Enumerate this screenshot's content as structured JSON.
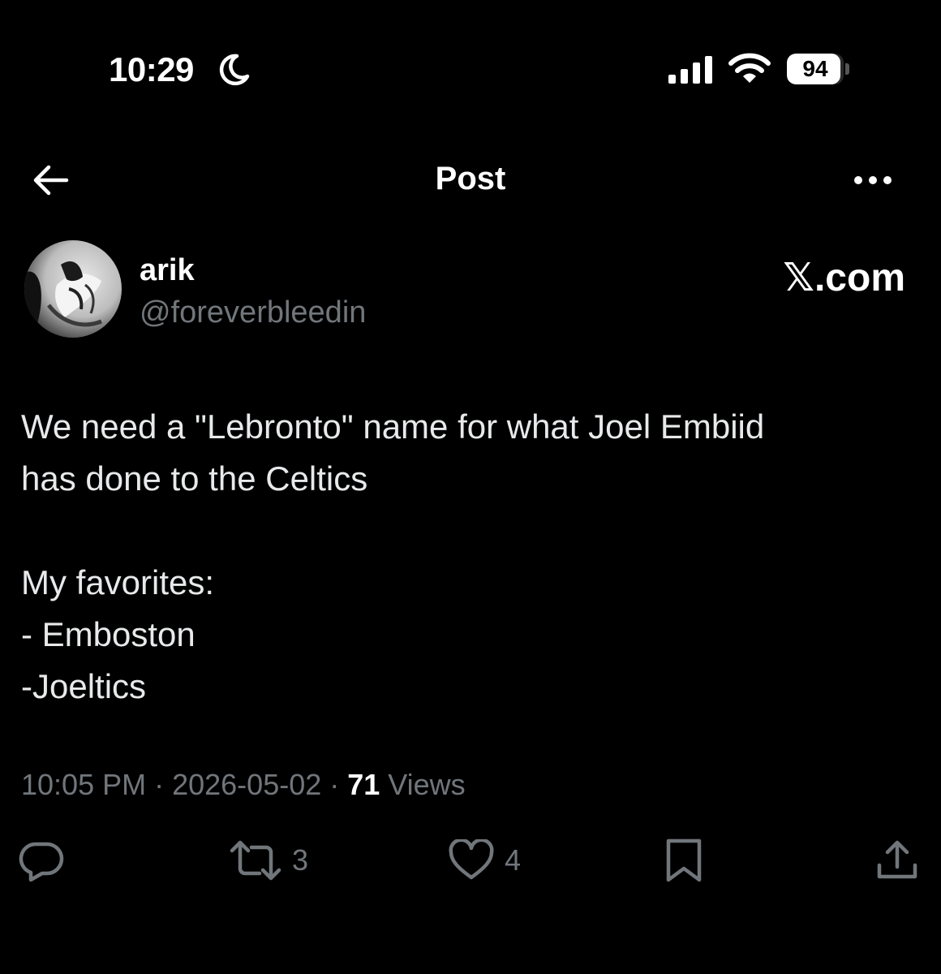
{
  "status_bar": {
    "time": "10:29",
    "battery_level": "94",
    "battery_fraction": 0.94
  },
  "nav": {
    "title": "Post"
  },
  "author": {
    "name": "arik",
    "handle": "@foreverbleedin"
  },
  "source_label": "𝕏.com",
  "post": {
    "text_lines": [
      "We need a \"Lebronto\" name for what Joel Embiid",
      "has done to the Celtics",
      "",
      "My favorites:",
      "- Emboston",
      "-Joeltics"
    ],
    "time": "10:05 PM",
    "date": "2026-05-02",
    "separator": " · ",
    "views_count": "71",
    "views_label": " Views"
  },
  "actions": {
    "reposts": "3",
    "likes": "4"
  },
  "icons": {
    "status": [
      "moon-icon",
      "signal-icon",
      "wifi-icon",
      "battery-icon"
    ],
    "nav": [
      "back-arrow-icon",
      "more-icon"
    ],
    "actions": [
      "reply-icon",
      "repost-icon",
      "like-icon",
      "bookmark-icon",
      "share-icon"
    ]
  },
  "colors": {
    "background": "#000000",
    "text": "#e7e9ea",
    "secondary": "#71767b"
  }
}
